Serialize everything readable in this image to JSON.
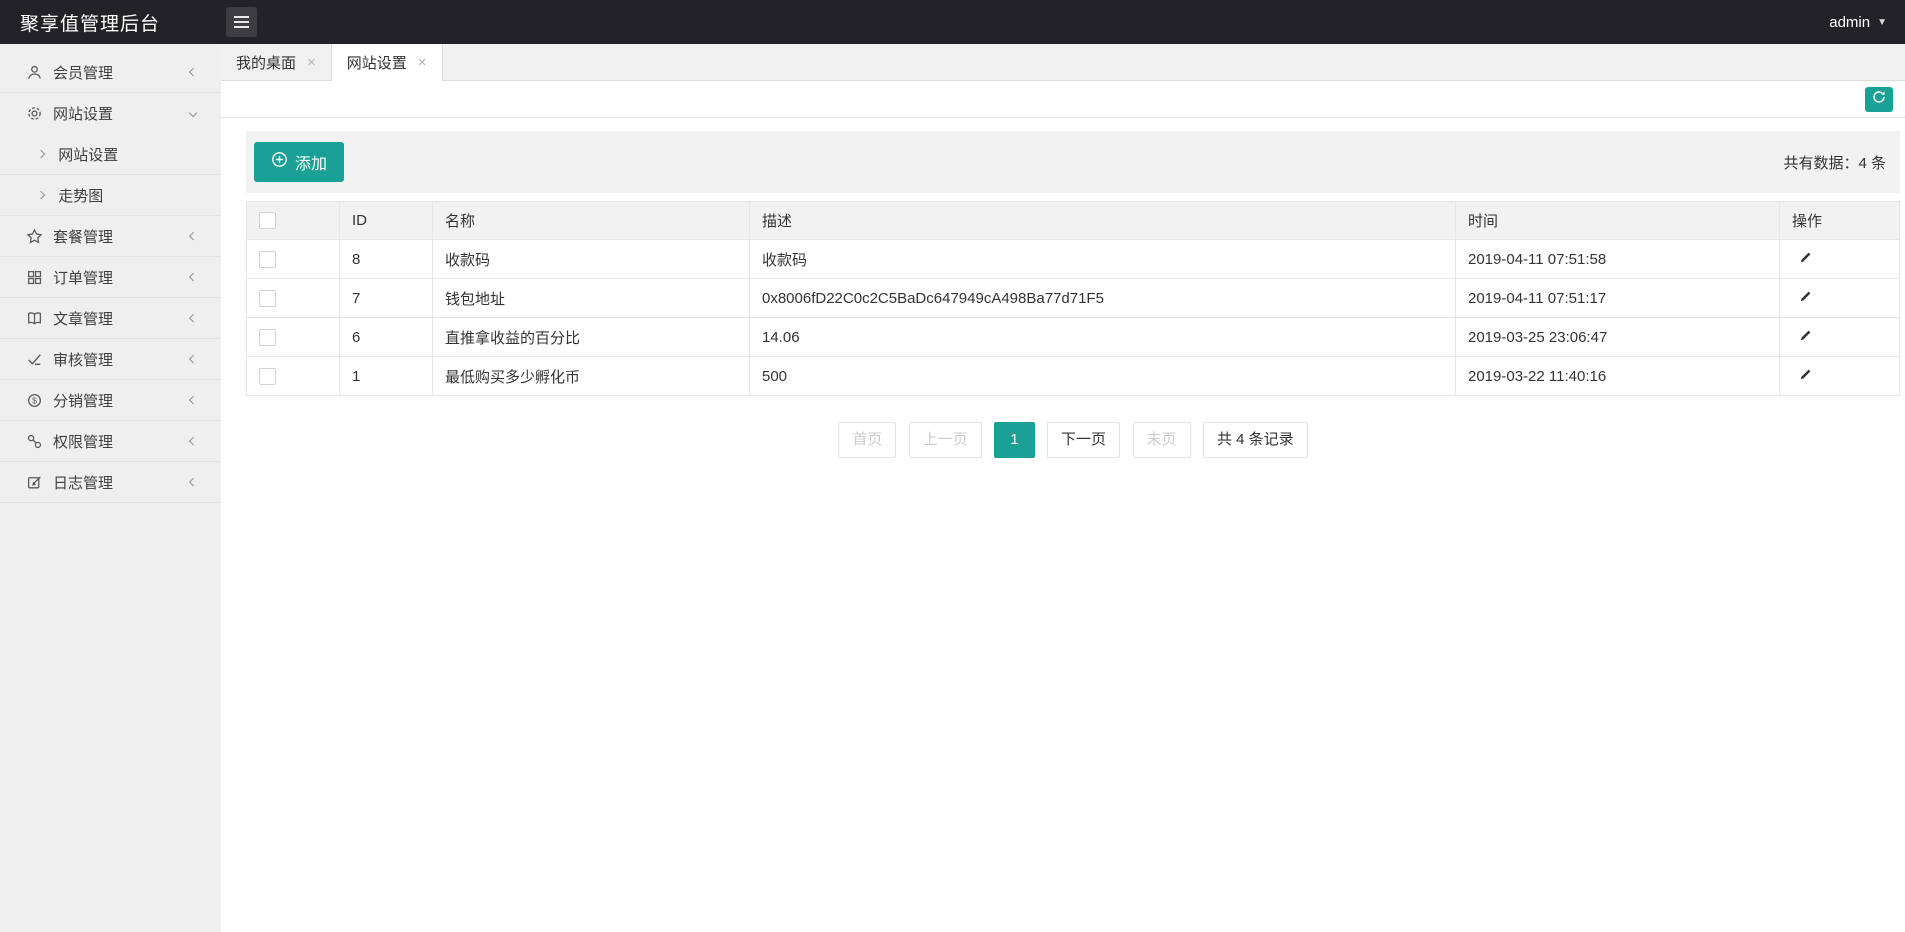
{
  "header": {
    "title": "聚享值管理后台",
    "user": "admin"
  },
  "icons": {
    "close": "×",
    "caret_down": "▼"
  },
  "tabs": [
    {
      "label": "我的桌面",
      "active": false
    },
    {
      "label": "网站设置",
      "active": true
    }
  ],
  "sidebar": {
    "items": [
      {
        "label": "会员管理",
        "icon": "user-icon",
        "state": "collapsed"
      },
      {
        "label": "网站设置",
        "icon": "gear-icon",
        "state": "expanded",
        "children": [
          {
            "label": "网站设置"
          },
          {
            "label": "走势图"
          }
        ]
      },
      {
        "label": "套餐管理",
        "icon": "star-icon",
        "state": "collapsed"
      },
      {
        "label": "订单管理",
        "icon": "grid-icon",
        "state": "collapsed"
      },
      {
        "label": "文章管理",
        "icon": "book-icon",
        "state": "collapsed"
      },
      {
        "label": "审核管理",
        "icon": "audit-icon",
        "state": "collapsed"
      },
      {
        "label": "分销管理",
        "icon": "dollar-icon",
        "state": "collapsed"
      },
      {
        "label": "权限管理",
        "icon": "link-icon",
        "state": "collapsed"
      },
      {
        "label": "日志管理",
        "icon": "log-icon",
        "state": "collapsed"
      }
    ]
  },
  "toolbar": {
    "add_label": "添加",
    "total_label": "共有数据：4 条"
  },
  "table": {
    "columns": [
      "ID",
      "名称",
      "描述",
      "时间",
      "操作"
    ],
    "rows": [
      {
        "id": "8",
        "name": "收款码",
        "desc": "收款码",
        "time": "2019-04-11 07:51:58"
      },
      {
        "id": "7",
        "name": "钱包地址",
        "desc": "0x8006fD22C0c2C5BaDc647949cA498Ba77d71F5",
        "time": "2019-04-11 07:51:17"
      },
      {
        "id": "6",
        "name": "直推拿收益的百分比",
        "desc": "14.06",
        "time": "2019-03-25 23:06:47"
      },
      {
        "id": "1",
        "name": "最低购买多少孵化币",
        "desc": "500",
        "time": "2019-03-22 11:40:16"
      }
    ]
  },
  "pagination": {
    "first": "首页",
    "prev": "上一页",
    "current": "1",
    "next": "下一页",
    "last": "末页",
    "total": "共 4 条记录"
  },
  "colors": {
    "accent": "#1AA094",
    "header_bg": "#232327"
  }
}
